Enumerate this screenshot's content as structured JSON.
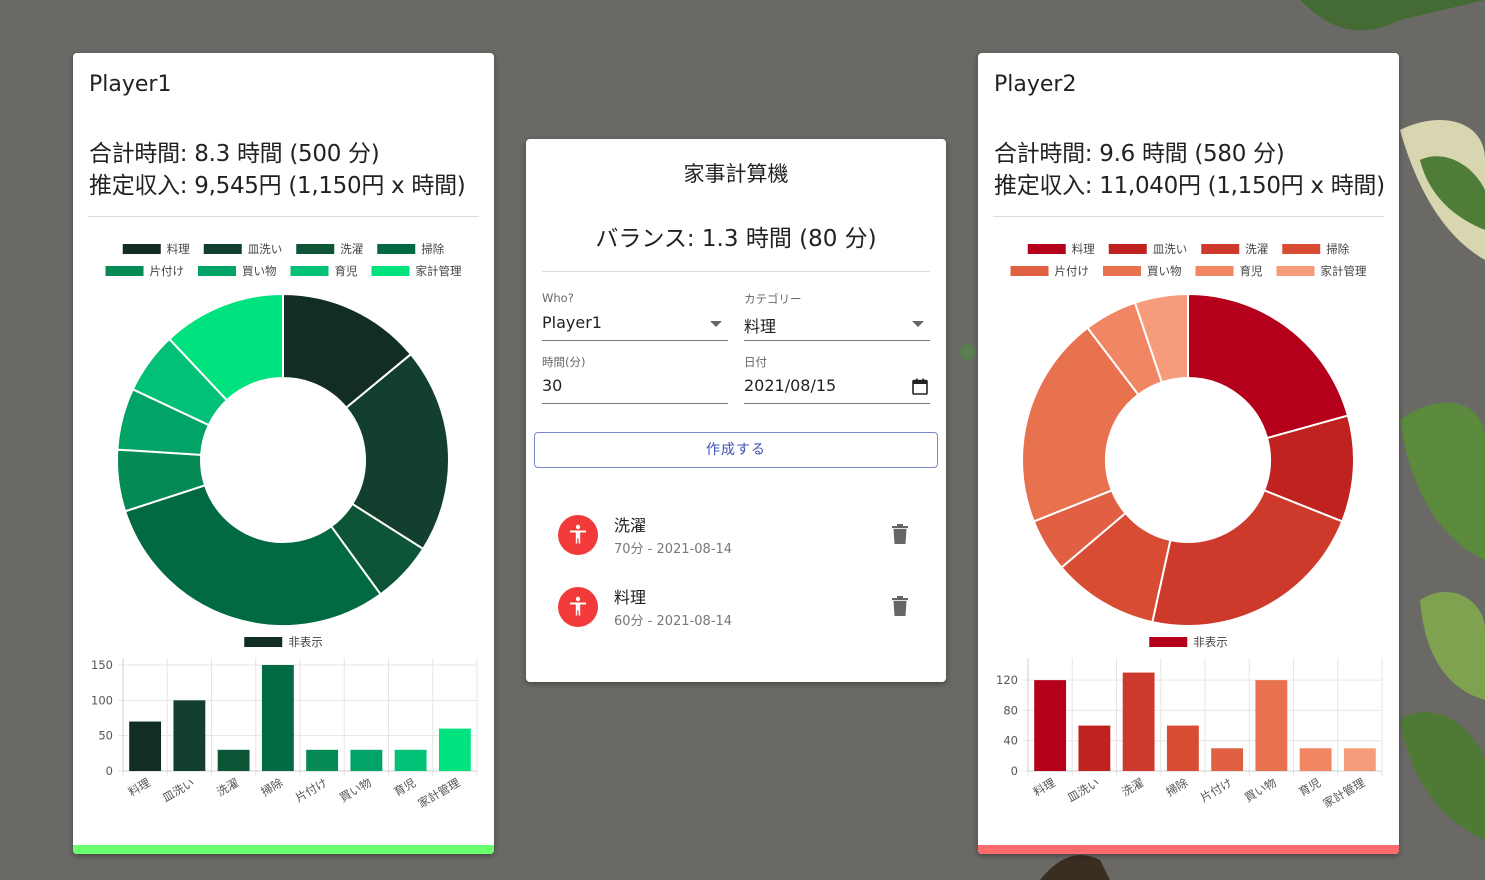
{
  "colors": {
    "background": "#6b6966",
    "player1_accent": "#69ff6f",
    "player2_accent": "#ff6a6f",
    "button_text": "#3f51b5",
    "avatar_red": "#f23a3a"
  },
  "player1": {
    "name": "Player1",
    "total_time": "合計時間: 8.3 時間 (500 分)",
    "estimated_income": "推定収入: 9,545円 (1,150円 x 時間)",
    "hidden_legend_label": "非表示",
    "palette": [
      "#122d22",
      "#133f2e",
      "#0d5536",
      "#016a42",
      "#058a56",
      "#01a466",
      "#02c177",
      "#00e27d"
    ]
  },
  "player2": {
    "name": "Player2",
    "total_time": "合計時間: 9.6 時間 (580 分)",
    "estimated_income": "推定収入: 11,040円 (1,150円 x 時間)",
    "hidden_legend_label": "非表示",
    "palette": [
      "#b4001a",
      "#c0221f",
      "#cd3a2c",
      "#d84c34",
      "#e15f43",
      "#e8714e",
      "#f08663",
      "#f79c7b"
    ]
  },
  "calculator": {
    "title": "家事計算機",
    "balance": "バランス: 1.3 時間 (80 分)",
    "who_label": "Who?",
    "who_value": "Player1",
    "category_label": "カテゴリー",
    "category_value": "料理",
    "time_label": "時間(分)",
    "time_value": "30",
    "date_label": "日付",
    "date_value": "2021/08/15",
    "create_button": "作成する",
    "entries": [
      {
        "title": "洗濯",
        "subtitle": "70分 - 2021-08-14",
        "icon": "accessibility-icon"
      },
      {
        "title": "料理",
        "subtitle": "60分 - 2021-08-14",
        "icon": "accessibility-icon"
      }
    ]
  },
  "chart_data": [
    {
      "type": "doughnut+bar",
      "player": "Player1",
      "categories": [
        "料理",
        "皿洗い",
        "洗濯",
        "掃除",
        "片付け",
        "買い物",
        "育児",
        "家計管理"
      ],
      "values": [
        70,
        100,
        30,
        150,
        30,
        30,
        30,
        60
      ],
      "ylim": [
        0,
        150
      ],
      "yticks": [
        0,
        50,
        100,
        150
      ],
      "grid": true,
      "legend": "top"
    },
    {
      "type": "doughnut+bar",
      "player": "Player2",
      "categories": [
        "料理",
        "皿洗い",
        "洗濯",
        "掃除",
        "片付け",
        "買い物",
        "育児",
        "家計管理"
      ],
      "values": [
        120,
        60,
        130,
        60,
        30,
        120,
        30,
        30
      ],
      "ylim": [
        0,
        140
      ],
      "yticks": [
        0,
        40,
        80,
        120
      ],
      "grid": true,
      "legend": "top"
    }
  ]
}
